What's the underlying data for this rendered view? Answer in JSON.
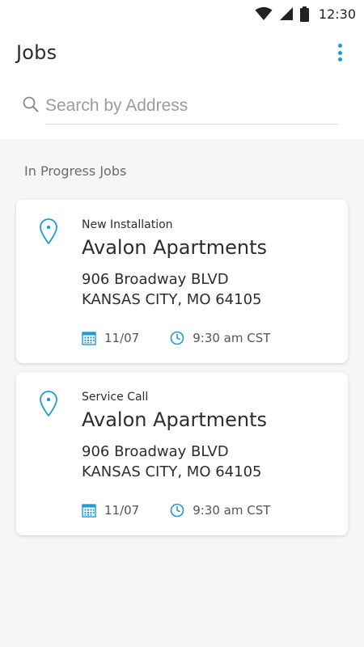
{
  "status_bar": {
    "time": "12:30",
    "icons": [
      "wifi-icon",
      "signal-icon",
      "battery-icon"
    ]
  },
  "header": {
    "title": "Jobs",
    "menu_icon": "more-vertical-icon"
  },
  "search": {
    "placeholder": "Search by Address",
    "icon": "search-icon"
  },
  "section": {
    "title": "In Progress Jobs"
  },
  "jobs": [
    {
      "type": "New Installation",
      "name": "Avalon Apartments",
      "address_line1": "906 Broadway BLVD",
      "address_line2": "KANSAS CITY, MO 64105",
      "date": "11/07",
      "time": "9:30 am CST"
    },
    {
      "type": "Service Call",
      "name": "Avalon Apartments",
      "address_line1": "906 Broadway BLVD",
      "address_line2": "KANSAS CITY, MO 64105",
      "date": "11/07",
      "time": "9:30 am CST"
    }
  ],
  "colors": {
    "accent": "#1b9bd7",
    "background": "#f4f6f8",
    "card": "#ffffff",
    "text": "#2d2d2d"
  }
}
